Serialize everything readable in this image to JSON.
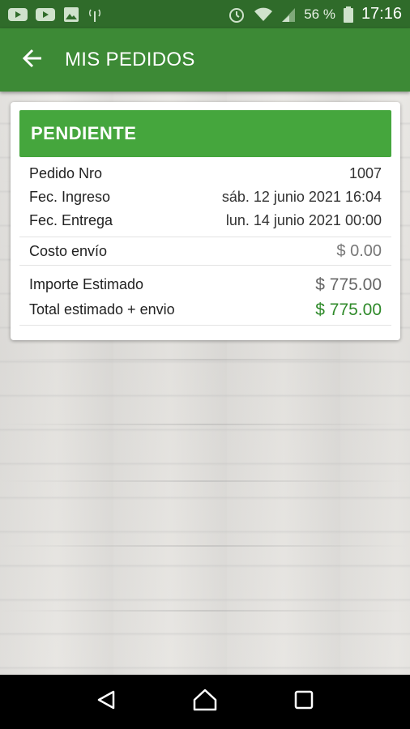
{
  "status_bar": {
    "battery_percent": "56 %",
    "time": "17:16",
    "icons_left": [
      "youtube-icon",
      "youtube-icon",
      "image-icon",
      "signal-tower-icon"
    ],
    "icons_right": [
      "alarm-icon",
      "wifi-icon",
      "cell-signal-icon",
      "battery-icon"
    ]
  },
  "app_bar": {
    "title": "MIS PEDIDOS",
    "back_icon": "arrow-left-icon"
  },
  "order": {
    "status": "PENDIENTE",
    "status_color": "#45a63d",
    "pedido_label": "Pedido Nro",
    "pedido_value": "1007",
    "ingreso_label": "Fec. Ingreso",
    "ingreso_value": "sáb. 12 junio 2021 16:04",
    "entrega_label": "Fec. Entrega",
    "entrega_value": "lun. 14 junio 2021 00:00",
    "costo_label": "Costo envío",
    "costo_value": "$ 0.00",
    "importe_label": "Importe Estimado",
    "importe_value": "$ 775.00",
    "total_label": "Total estimado + envio",
    "total_value": "$ 775.00",
    "total_color": "#2f8a2a"
  },
  "colors": {
    "status_bar": "#2f6b2a",
    "app_bar": "#3d8a36"
  },
  "nav_bar": {
    "icons": [
      "back-triangle-icon",
      "home-icon",
      "recents-square-icon"
    ]
  }
}
